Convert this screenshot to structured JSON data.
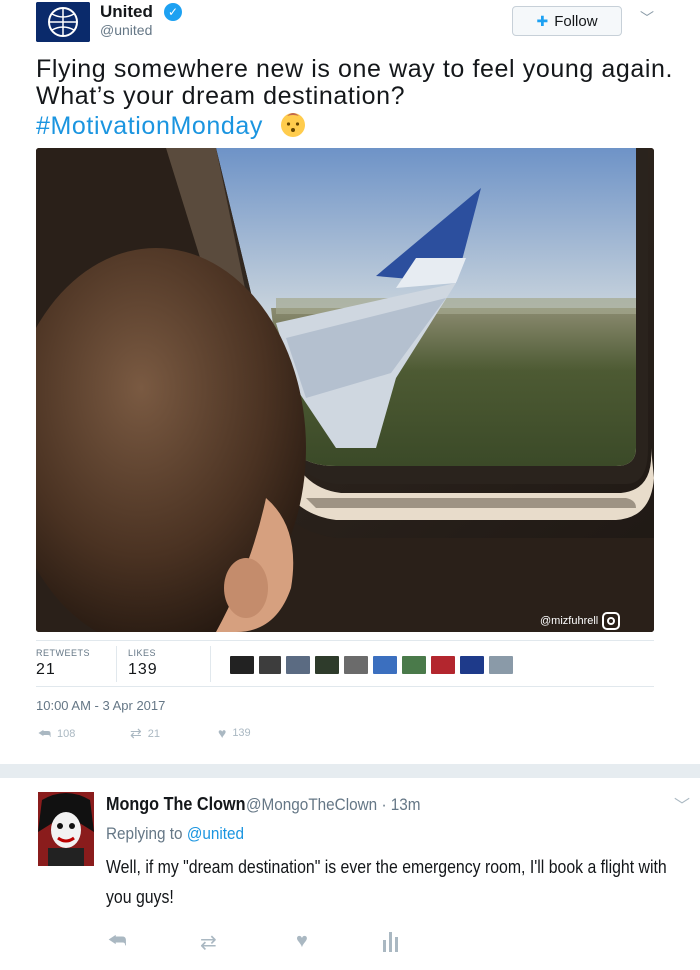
{
  "tweet": {
    "author": {
      "name": "United",
      "handle": "@united",
      "verified_icon": "verified-badge-icon"
    },
    "follow_label": "Follow",
    "text": "Flying somewhere new is one way to feel young again. What’s your dream destination?",
    "hashtag": "#MotivationMonday",
    "emoji": "baby-face-emoji",
    "photo": {
      "description": "child-looking-out-airplane-window",
      "watermark": "@mizfuhrell"
    },
    "stats": {
      "retweets_label": "RETWEETS",
      "retweets": "21",
      "likes_label": "LIKES",
      "likes": "139"
    },
    "timestamp": "10:00 AM - 3 Apr 2017",
    "actions": {
      "reply_count": "108",
      "retweet_count": "21",
      "like_count": "139"
    }
  },
  "reply": {
    "author_name": "Mongo The Clown",
    "author_handle": "@MongoTheClown · 13m",
    "replying_prefix": "Replying to",
    "replying_to": "@united",
    "text": "Well, if my \"dream destination\" is ever the emergency room, I'll book a flight with you guys!"
  },
  "colors": {
    "link": "#1b95e0",
    "secondary_text": "#657786",
    "divider": "#e1e8ed",
    "action_icon": "#aab8c2"
  }
}
